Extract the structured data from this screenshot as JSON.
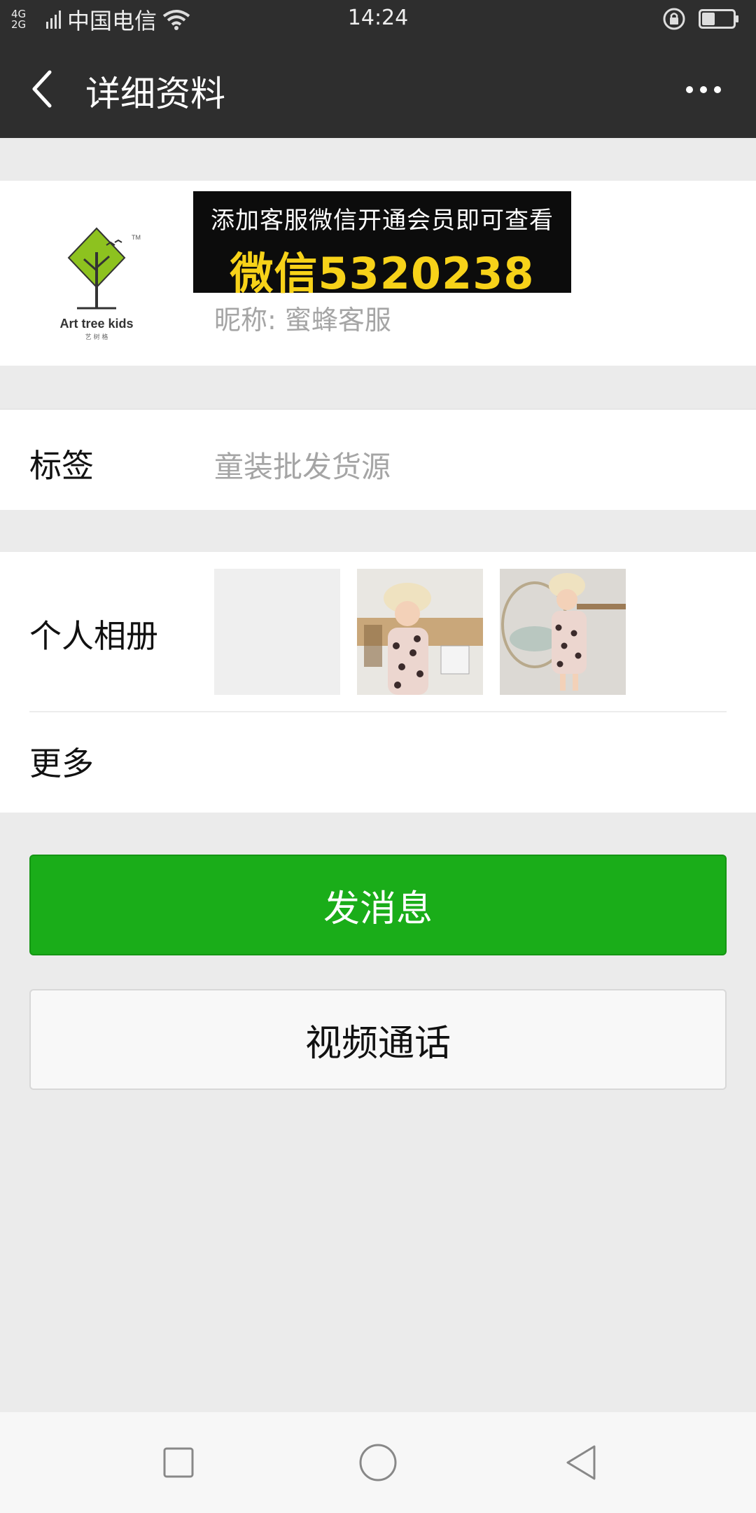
{
  "status_bar": {
    "network": "4G 2G",
    "carrier": "中国电信",
    "time": "14:24",
    "battery_level": 0.4
  },
  "header": {
    "title": "详细资料"
  },
  "profile": {
    "avatar_text": "Art tree kids",
    "avatar_subtext": "艺 树 格",
    "avatar_tm": "TM",
    "banner_line1": "添加客服微信开通会员即可查看",
    "banner_line2": "微信5320238",
    "nickname": "昵称: 蜜蜂客服"
  },
  "tags": {
    "label": "标签",
    "value": "童装批发货源"
  },
  "album": {
    "label": "个人相册",
    "more_label": "更多"
  },
  "actions": {
    "send_message": "发消息",
    "video_call": "视频通话"
  },
  "colors": {
    "primary_green": "#1aad19",
    "header_bg": "#2e2e2e",
    "banner_yellow": "#f7d219"
  }
}
